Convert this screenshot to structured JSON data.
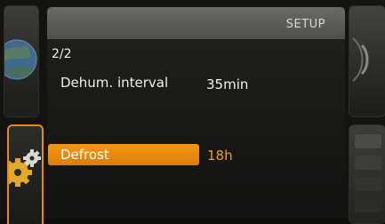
{
  "header": {
    "title": "SETUP"
  },
  "page": {
    "indicator": "2/2"
  },
  "rows": [
    {
      "label": "Dehum. interval",
      "value": "35min",
      "selected": false
    },
    {
      "label": "Defrost",
      "value": "18h",
      "selected": true
    }
  ],
  "icons": {
    "left_top": "globe-icon",
    "left_selected": "gears-icon",
    "right_top": "speaker-icon",
    "right_bottom": "menu-icon"
  },
  "colors": {
    "accent": "#f29011",
    "background": "#131311",
    "header": "#5a5a55",
    "text": "#f2f2ee"
  }
}
